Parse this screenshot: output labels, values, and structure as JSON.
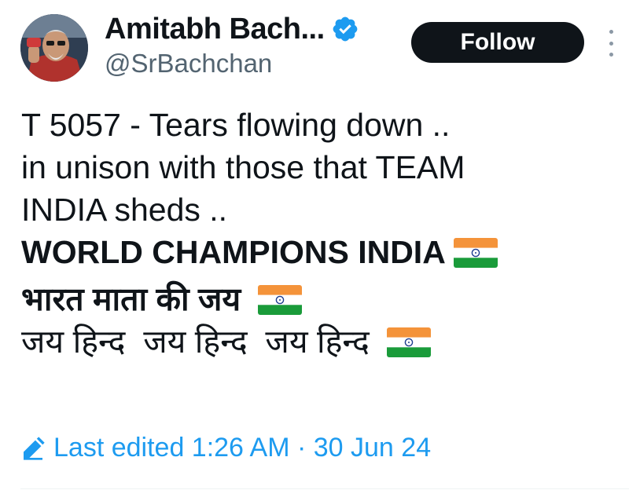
{
  "author": {
    "display_name": "Amitabh Bach...",
    "handle": "@SrBachchan",
    "verified": true
  },
  "actions": {
    "follow_label": "Follow"
  },
  "tweet": {
    "lines": [
      "T 5057 - Tears flowing down ..",
      "in unison with those that TEAM",
      "INDIA sheds ..",
      "WORLD CHAMPIONS INDIA",
      "भारत माता की जय",
      "जय हिन्द  जय हिन्द  जय हिन्द"
    ],
    "emoji": "indian-flag"
  },
  "edit_info": {
    "text": "Last edited 1:26 AM · 30 Jun 24"
  },
  "colors": {
    "accent": "#1d9bf0",
    "text": "#0f1419",
    "secondary": "#536471",
    "follow_bg": "#0f1419"
  }
}
